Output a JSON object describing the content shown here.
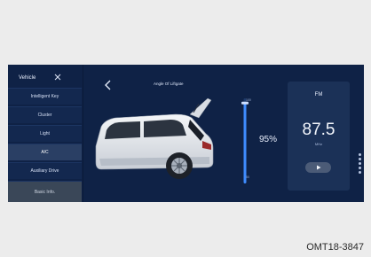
{
  "sidebar": {
    "title": "Vehicle",
    "items": [
      {
        "label": "Intelligent Key"
      },
      {
        "label": "Cluster"
      },
      {
        "label": "Light"
      },
      {
        "label": "A/C"
      },
      {
        "label": "Auxiliary Drive"
      },
      {
        "label": "Basic Info."
      }
    ]
  },
  "liftgate": {
    "title": "Angle Of Liftgate",
    "gauge_top": "100",
    "gauge_bottom": "50",
    "percent_text": "95%",
    "level_percent": 95
  },
  "radio": {
    "band": "FM",
    "frequency": "87.5",
    "unit": "MHz"
  },
  "caption": "OMT18-3847",
  "colors": {
    "screen_bg": "#0f2246",
    "gauge_active": "#3f8cff",
    "radio_panel": "#1b3157"
  }
}
